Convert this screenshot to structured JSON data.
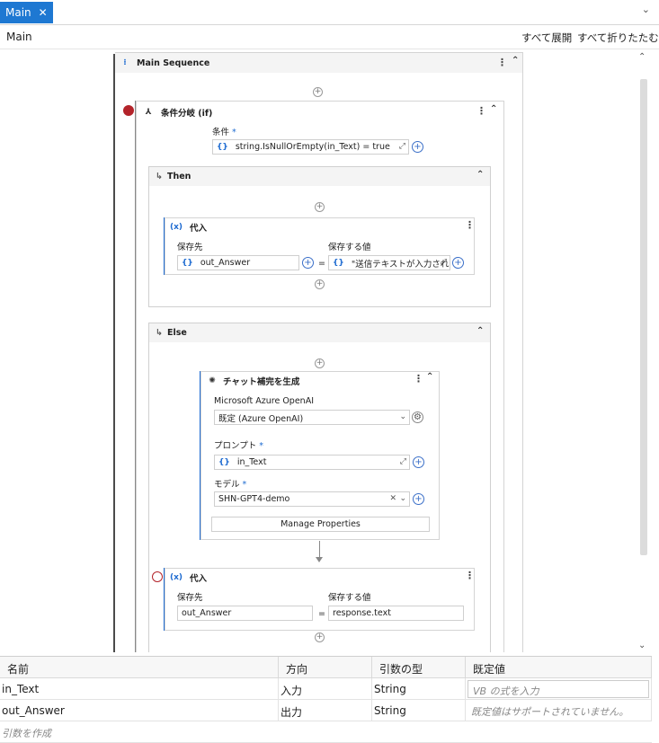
{
  "tab": {
    "label": "Main",
    "close": "✕",
    "dropdown": "⌄"
  },
  "header": {
    "workflow": "Main",
    "expand_all": "すべて展開",
    "collapse_all": "すべて折りたたむ"
  },
  "main_sequence": {
    "title": "Main Sequence"
  },
  "if_activity": {
    "title": "条件分岐 (if)",
    "condition_label": "条件",
    "condition_value": "string.IsNullOrEmpty(in_Text) = true"
  },
  "then_block": {
    "title": "Then",
    "assign": {
      "title": "代入",
      "to_label": "保存先",
      "value_label": "保存する値",
      "to_value": "out_Answer",
      "value_value": "\"送信テキストが入力され",
      "eq": "="
    }
  },
  "else_block": {
    "title": "Else",
    "chat": {
      "title": "チャット補完を生成",
      "connection_label": "Microsoft Azure OpenAI",
      "connection_value": "既定 (Azure OpenAI)",
      "prompt_label": "プロンプト",
      "prompt_value": "in_Text",
      "model_label": "モデル",
      "model_value": "SHN-GPT4-demo",
      "manage": "Manage Properties"
    },
    "assign": {
      "title": "代入",
      "to_label": "保存先",
      "value_label": "保存する値",
      "to_value": "out_Answer",
      "value_value": "response.text",
      "eq": "="
    }
  },
  "arguments": {
    "headers": [
      "名前",
      "方向",
      "引数の型",
      "既定値"
    ],
    "rows": [
      {
        "name": "in_Text",
        "direction": "入力",
        "type": "String",
        "default": "VB の式を入力"
      },
      {
        "name": "out_Answer",
        "direction": "出力",
        "type": "String",
        "default": "既定値はサポートされていません。"
      }
    ],
    "create": "引数を作成"
  },
  "colors": {
    "accent": "#1e78d2",
    "breakpoint": "#b3232a"
  }
}
